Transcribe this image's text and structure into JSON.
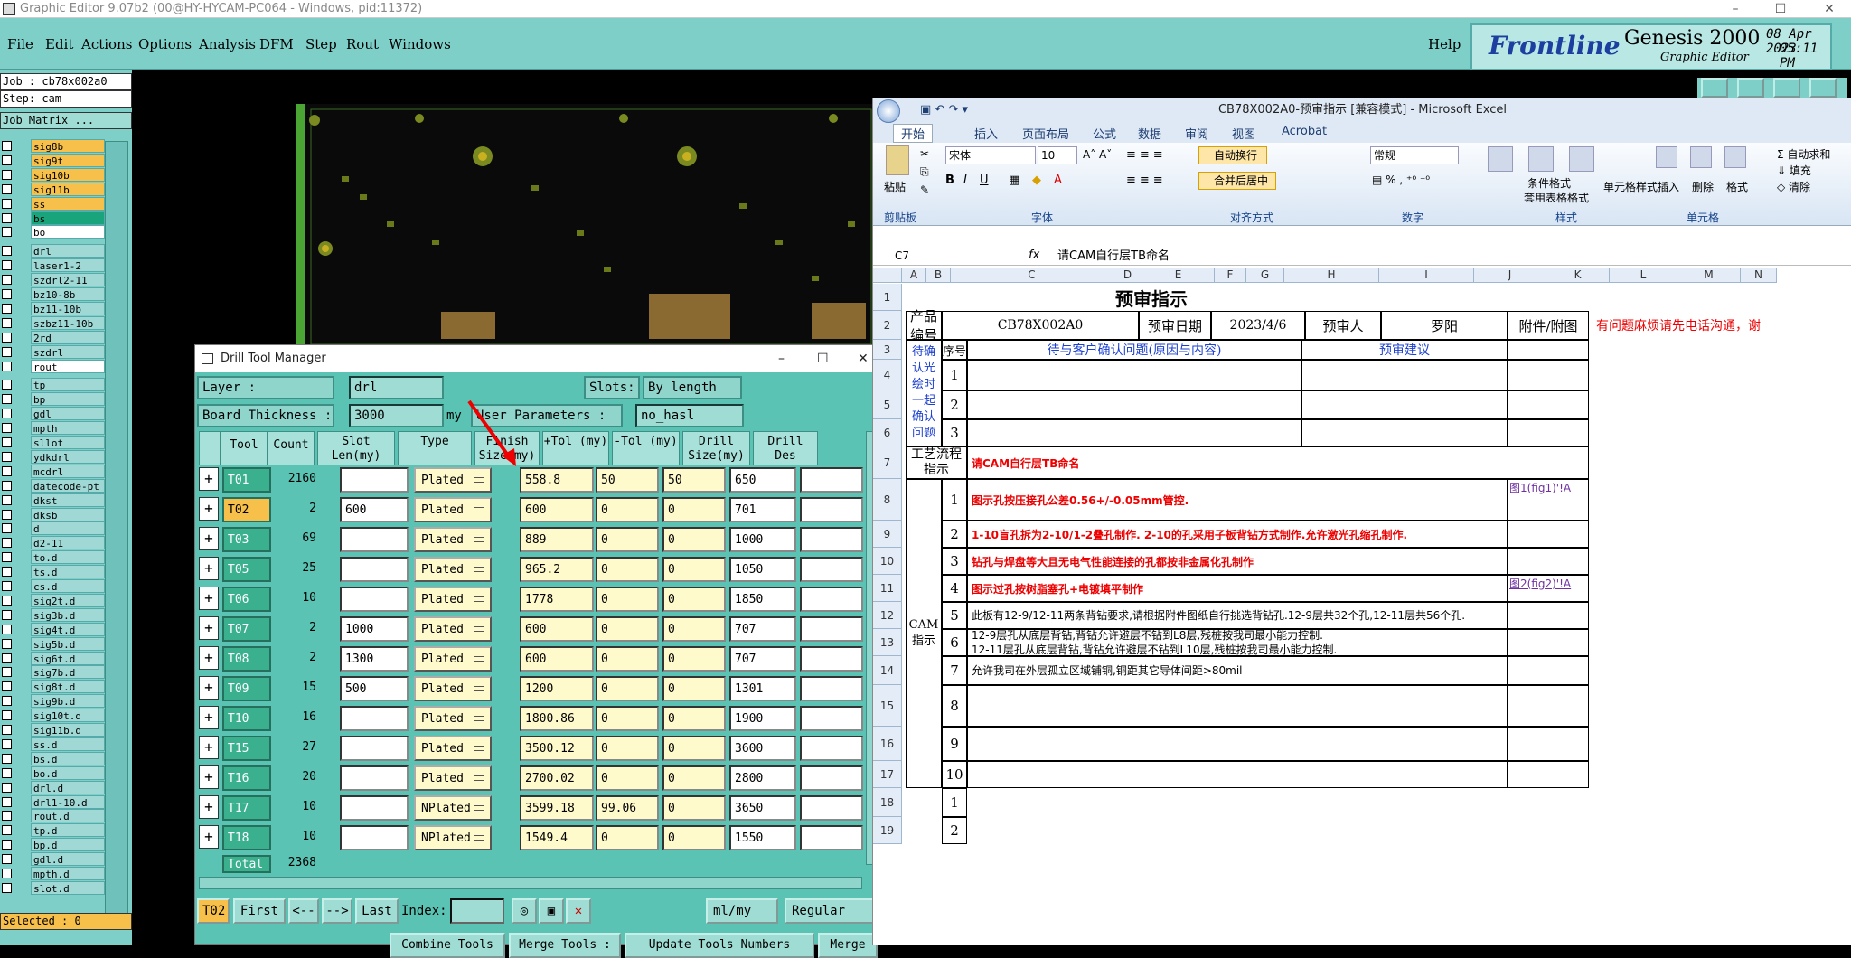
{
  "genesis": {
    "title": "Graphic Editor 9.07b2 (00@HY-HYCAM-PC064 - Windows, pid:11372)",
    "menu": [
      "File",
      "Edit",
      "Actions",
      "Options",
      "Analysis",
      "DFM",
      "Step",
      "Rout",
      "Windows"
    ],
    "help": "Help",
    "logo_brand": "Frontline",
    "logo_product": "Genesis 2000",
    "logo_sub": "Graphic Editor",
    "date": "08 Apr 2023",
    "time": "05:11 PM",
    "job": "Job : cb78x002a0",
    "step": "Step: cam",
    "matrix_btn": "Job Matrix ...",
    "selected": "Selected : 0",
    "layers": [
      {
        "n": "sig8b",
        "c": "org"
      },
      {
        "n": "sig9t",
        "c": "org"
      },
      {
        "n": "sig10b",
        "c": "org"
      },
      {
        "n": "sig11b",
        "c": "org"
      },
      {
        "n": "ss",
        "c": "org"
      },
      {
        "n": "bs",
        "c": "grn"
      },
      {
        "n": "bo",
        "c": "wht"
      },
      {
        "n": "drl",
        "c": ""
      },
      {
        "n": "laser1-2",
        "c": ""
      },
      {
        "n": "szdrl2-11",
        "c": ""
      },
      {
        "n": "bz10-8b",
        "c": ""
      },
      {
        "n": "bz11-10b",
        "c": ""
      },
      {
        "n": "szbz11-10b",
        "c": ""
      },
      {
        "n": "2rd",
        "c": ""
      },
      {
        "n": "szdrl",
        "c": ""
      },
      {
        "n": "rout",
        "c": "wht"
      },
      {
        "n": "tp",
        "c": ""
      },
      {
        "n": "bp",
        "c": ""
      },
      {
        "n": "gdl",
        "c": ""
      },
      {
        "n": "mpth",
        "c": ""
      },
      {
        "n": "sllot",
        "c": ""
      },
      {
        "n": "ydkdrl",
        "c": ""
      },
      {
        "n": "mcdrl",
        "c": ""
      },
      {
        "n": "datecode-pt",
        "c": ""
      },
      {
        "n": "dkst",
        "c": ""
      },
      {
        "n": "dksb",
        "c": ""
      },
      {
        "n": "d",
        "c": ""
      },
      {
        "n": "d2-11",
        "c": ""
      },
      {
        "n": "to.d",
        "c": ""
      },
      {
        "n": "ts.d",
        "c": ""
      },
      {
        "n": "cs.d",
        "c": ""
      },
      {
        "n": "sig2t.d",
        "c": ""
      },
      {
        "n": "sig3b.d",
        "c": ""
      },
      {
        "n": "sig4t.d",
        "c": ""
      },
      {
        "n": "sig5b.d",
        "c": ""
      },
      {
        "n": "sig6t.d",
        "c": ""
      },
      {
        "n": "sig7b.d",
        "c": ""
      },
      {
        "n": "sig8t.d",
        "c": ""
      },
      {
        "n": "sig9b.d",
        "c": ""
      },
      {
        "n": "sig10t.d",
        "c": ""
      },
      {
        "n": "sig11b.d",
        "c": ""
      },
      {
        "n": "ss.d",
        "c": ""
      },
      {
        "n": "bs.d",
        "c": ""
      },
      {
        "n": "bo.d",
        "c": ""
      },
      {
        "n": "drl.d",
        "c": ""
      },
      {
        "n": "drl1-10.d",
        "c": ""
      },
      {
        "n": "rout.d",
        "c": ""
      },
      {
        "n": "tp.d",
        "c": ""
      },
      {
        "n": "bp.d",
        "c": ""
      },
      {
        "n": "gdl.d",
        "c": ""
      },
      {
        "n": "mpth.d",
        "c": ""
      },
      {
        "n": "slot.d",
        "c": ""
      }
    ]
  },
  "drill": {
    "title": "Drill Tool Manager",
    "layer_label": "Layer         :",
    "layer": "drl",
    "slots_label": "Slots:",
    "slots": "By length",
    "thick_label": "Board Thickness :",
    "thick": "3000",
    "unit": "my",
    "user_label": "User Parameters :",
    "user": "no_hasl",
    "headers": [
      "Tool",
      "Count",
      "Slot Len(my)",
      "Type",
      "Finish Size(my)",
      "+Tol (my)",
      "-Tol (my)",
      "Drill Size(my)",
      "Drill Des"
    ],
    "rows": [
      [
        "T01",
        "2160",
        "",
        "Plated",
        "558.8",
        "50",
        "50",
        "650",
        ""
      ],
      [
        "T02",
        "2",
        "600",
        "Plated",
        "600",
        "0",
        "0",
        "701",
        ""
      ],
      [
        "T03",
        "69",
        "",
        "Plated",
        "889",
        "0",
        "0",
        "1000",
        ""
      ],
      [
        "T05",
        "25",
        "",
        "Plated",
        "965.2",
        "0",
        "0",
        "1050",
        ""
      ],
      [
        "T06",
        "10",
        "",
        "Plated",
        "1778",
        "0",
        "0",
        "1850",
        ""
      ],
      [
        "T07",
        "2",
        "1000",
        "Plated",
        "600",
        "0",
        "0",
        "707",
        ""
      ],
      [
        "T08",
        "2",
        "1300",
        "Plated",
        "600",
        "0",
        "0",
        "707",
        ""
      ],
      [
        "T09",
        "15",
        "500",
        "Plated",
        "1200",
        "0",
        "0",
        "1301",
        ""
      ],
      [
        "T10",
        "16",
        "",
        "Plated",
        "1800.86",
        "0",
        "0",
        "1900",
        ""
      ],
      [
        "T15",
        "27",
        "",
        "Plated",
        "3500.12",
        "0",
        "0",
        "3600",
        ""
      ],
      [
        "T16",
        "20",
        "",
        "Plated",
        "2700.02",
        "0",
        "0",
        "2800",
        ""
      ],
      [
        "T17",
        "10",
        "",
        "NPlated",
        "3599.18",
        "99.06",
        "0",
        "3650",
        ""
      ],
      [
        "T18",
        "10",
        "",
        "NPlated",
        "1549.4",
        "0",
        "0",
        "1550",
        ""
      ]
    ],
    "total_label": "Total",
    "total": "2368",
    "cur_tool": "T02",
    "first": "First",
    "prev": "<--",
    "next": "-->",
    "last": "Last",
    "index": "Index:",
    "unit_sel": "ml/my",
    "mode_sel": "Regular",
    "bottom_btns": [
      "Combine Tools",
      "Merge Tools :",
      "Update Tools Numbers",
      "Merge"
    ]
  },
  "excel": {
    "title": "CB78X002A0-预审指示  [兼容模式] - Microsoft Excel",
    "tabs": [
      "开始",
      "插入",
      "页面布局",
      "公式",
      "数据",
      "审阅",
      "视图",
      "Acrobat"
    ],
    "font": "宋体",
    "size": "10",
    "numfmt": "常规",
    "wrap": "自动换行",
    "merge": "合并后居中",
    "groups": [
      "剪贴板",
      "字体",
      "对齐方式",
      "数字",
      "样式",
      "单元格"
    ],
    "style_btns": [
      "条件格式",
      "套用表格格式",
      "单元格样式"
    ],
    "cell_btns": [
      "插入",
      "删除",
      "格式"
    ],
    "edit_btns": [
      "自动求和",
      "填充",
      "清除"
    ],
    "paste": "粘贴",
    "namebox": "C7",
    "formula": "请CAM自行层TB命名",
    "cols": [
      "A",
      "B",
      "C",
      "D",
      "E",
      "F",
      "G",
      "H",
      "I",
      "J",
      "K",
      "L",
      "M",
      "N"
    ],
    "rows": [
      "1",
      "2",
      "3",
      "4",
      "5",
      "6",
      "7",
      "8",
      "9",
      "10",
      "11",
      "12",
      "13",
      "14",
      "15",
      "16",
      "17",
      "18",
      "19"
    ],
    "sheet": {
      "title": "预审指示",
      "prod_label": "产品编号",
      "prod": "CB78X002A0",
      "date_label": "预审日期",
      "date": "2023/4/6",
      "reviewer_label": "预审人",
      "reviewer": "罗阳",
      "attach": "附件/附图",
      "contact": "有问题麻烦请先电话沟通，谢",
      "seq": "序号",
      "issue": "待与客户确认问题(原因与内容)",
      "suggest": "预审建议",
      "confirm": "待确认光绘时一起确认问题",
      "flow": "工艺流程指示",
      "flow_text": "请CAM自行层TB命名",
      "cam": "CAM指示",
      "items": [
        "图示孔按压接孔公差0.56+/-0.05mm管控.",
        "1-10盲孔拆为2-10/1-2叠孔制作. 2-10的孔采用子板背钻方式制作.允许激光孔缩孔制作.",
        "钻孔与焊盘等大且无电气性能连接的孔都按非金属化孔制作",
        "图示过孔按树脂塞孔+电镀填平制作",
        "此板有12-9/12-11两条背钻要求,请根据附件图纸自行挑选背钻孔.12-9层共32个孔,12-11层共56个孔.",
        "12-9层孔从底层背钻,背钻允许避层不钻到L8层,残桩按我司最小能力控制.\n12-11层孔从底层背钻,背钻允许避层不钻到L10层,残桩按我司最小能力控制.",
        "允许我司在外层孤立区域铺铜,铜距其它导体间距>80mil"
      ],
      "links": [
        "图1(fig1)'!A",
        "图2(fig2)'!A"
      ]
    }
  }
}
